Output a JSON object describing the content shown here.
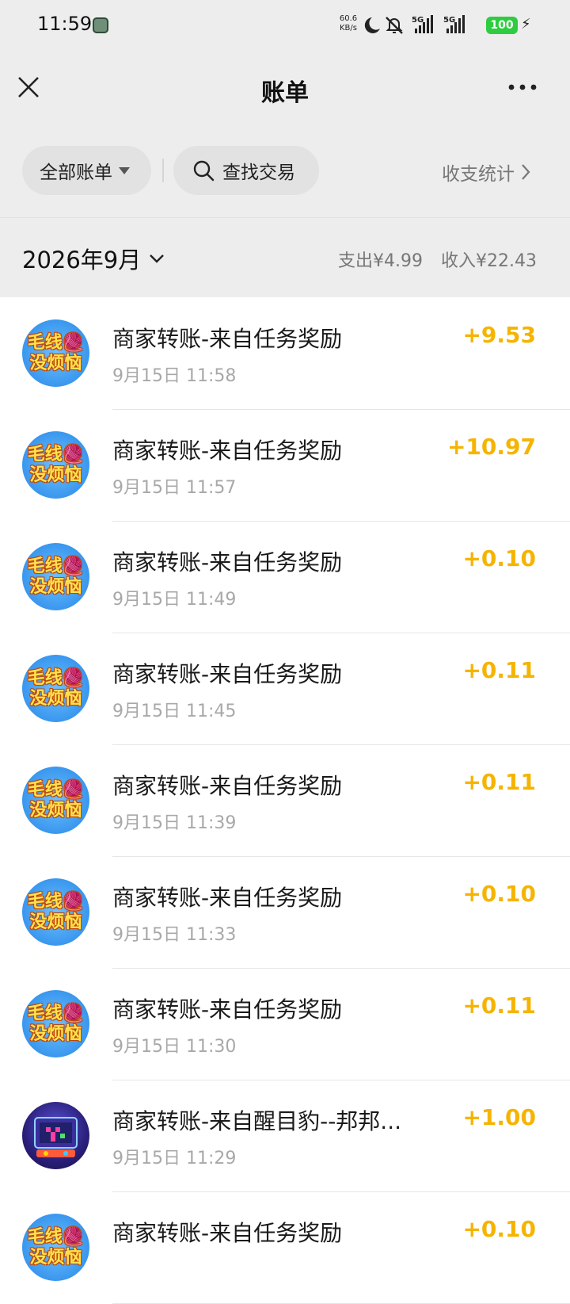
{
  "status_bar": {
    "time": "11:59",
    "speed_value": "60.6",
    "speed_unit": "KB/s",
    "network1": "5G",
    "network2": "5G",
    "battery": "100"
  },
  "header": {
    "title": "账单"
  },
  "filters": {
    "all_bills_label": "全部账单",
    "search_label": "查找交易",
    "stats_label": "收支统计"
  },
  "month": {
    "label": "2026年9月",
    "expense": "支出¥4.99",
    "income": "收入¥22.43"
  },
  "colors": {
    "income_amount": "#f5b400",
    "background": "#ededed"
  },
  "transactions": [
    {
      "title": "商家转账-来自任务奖励",
      "time": "9月15日 11:58",
      "amount": "+9.53",
      "avatar": "毛线没烦恼"
    },
    {
      "title": "商家转账-来自任务奖励",
      "time": "9月15日 11:57",
      "amount": "+10.97",
      "avatar": "毛线没烦恼"
    },
    {
      "title": "商家转账-来自任务奖励",
      "time": "9月15日 11:49",
      "amount": "+0.10",
      "avatar": "毛线没烦恼"
    },
    {
      "title": "商家转账-来自任务奖励",
      "time": "9月15日 11:45",
      "amount": "+0.11",
      "avatar": "毛线没烦恼"
    },
    {
      "title": "商家转账-来自任务奖励",
      "time": "9月15日 11:39",
      "amount": "+0.11",
      "avatar": "毛线没烦恼"
    },
    {
      "title": "商家转账-来自任务奖励",
      "time": "9月15日 11:33",
      "amount": "+0.10",
      "avatar": "毛线没烦恼"
    },
    {
      "title": "商家转账-来自任务奖励",
      "time": "9月15日 11:30",
      "amount": "+0.11",
      "avatar": "毛线没烦恼"
    },
    {
      "title": "商家转账-来自醒目豹--邦邦...",
      "time": "9月15日 11:29",
      "amount": "+1.00",
      "avatar": "game"
    },
    {
      "title": "商家转账-来自任务奖励",
      "time": "",
      "amount": "+0.10",
      "avatar": "毛线没烦恼"
    }
  ]
}
